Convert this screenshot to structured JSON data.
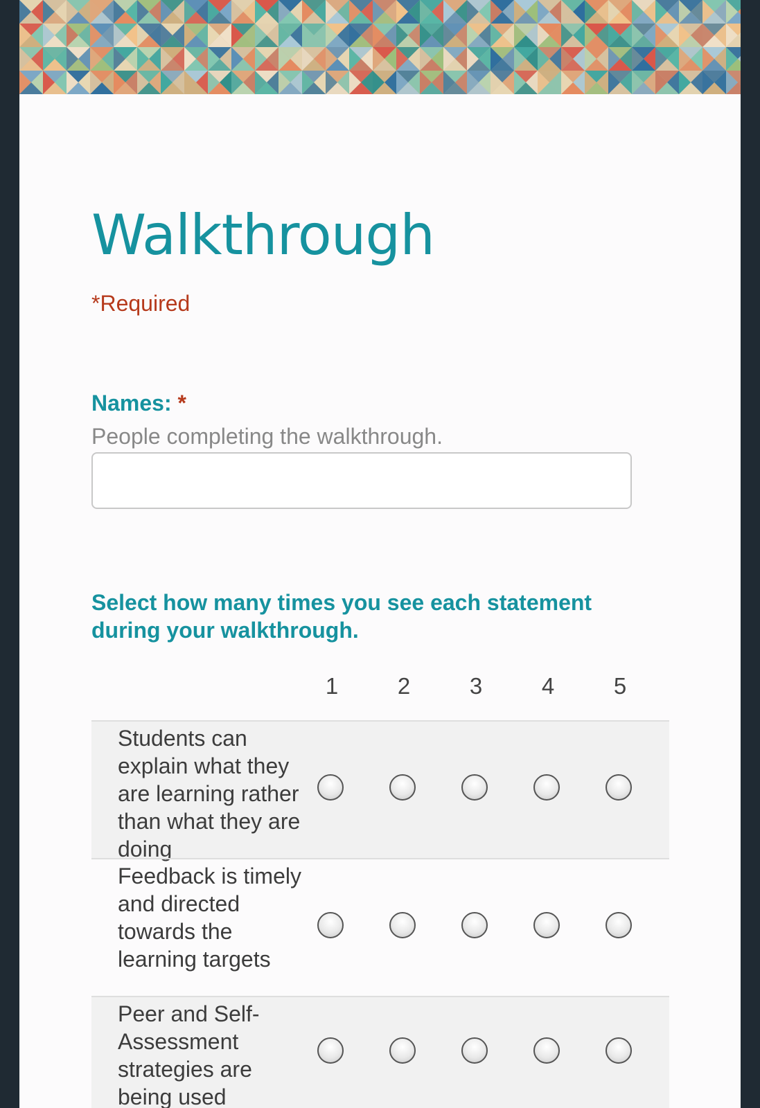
{
  "form": {
    "title": "Walkthrough",
    "required_note": "*Required"
  },
  "question_names": {
    "title": "Names:",
    "required_mark": "*",
    "help_text": "People completing the walkthrough.",
    "value": ""
  },
  "question_grid": {
    "title": "Select how many times you see each statement during your walkthrough.",
    "columns": [
      "1",
      "2",
      "3",
      "4",
      "5"
    ],
    "rows": [
      "Students can explain what they are learning rather than what they are doing",
      "Feedback is timely and directed towards the learning targets",
      "Peer and Self-Assessment strategies are being used"
    ]
  },
  "colors": {
    "accent": "#16929f",
    "required": "#b63a1c",
    "frame": "#1f2a33"
  },
  "icons": {
    "radio": "radio-button-unchecked-icon"
  }
}
